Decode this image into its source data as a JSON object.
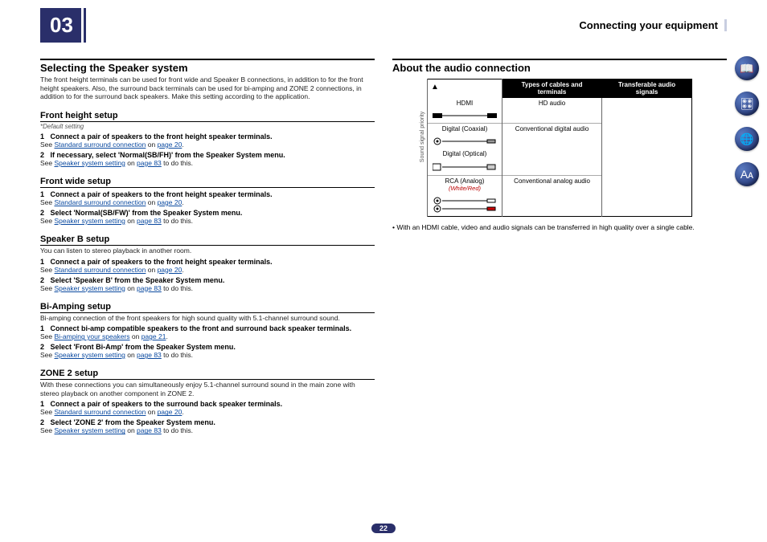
{
  "chapter_number": "03",
  "chapter_title": "Connecting your equipment",
  "page_number": "22",
  "left": {
    "h2": "Selecting the Speaker system",
    "intro": "The front height terminals can be used for front wide and Speaker B connections, in addition to for the front height speakers. Also, the surround back terminals can be used for bi-amping and ZONE 2 connections, in addition to for the surround back speakers. Make this setting according to the application.",
    "sections": [
      {
        "title": "Front height setup",
        "note": "*Default setting",
        "steps": [
          {
            "n": "1",
            "bold": "Connect a pair of speakers to the front height speaker terminals.",
            "see_pre": "See ",
            "link": "Standard surround connection",
            "see_mid": " on ",
            "pg": "page 20",
            "see_post": "."
          },
          {
            "n": "2",
            "bold": "If necessary, select 'Normal(SB/FH)' from the Speaker System menu.",
            "see_pre": "See ",
            "link": "Speaker system setting",
            "see_mid": " on ",
            "pg": "page 83",
            "see_post": " to do this."
          }
        ]
      },
      {
        "title": "Front wide setup",
        "steps": [
          {
            "n": "1",
            "bold": "Connect a pair of speakers to the front height speaker terminals.",
            "see_pre": "See ",
            "link": "Standard surround connection",
            "see_mid": " on ",
            "pg": "page 20",
            "see_post": "."
          },
          {
            "n": "2",
            "bold": "Select 'Normal(SB/FW)' from the Speaker System menu.",
            "see_pre": "See ",
            "link": "Speaker system setting",
            "see_mid": " on ",
            "pg": "page 83",
            "see_post": " to do this."
          }
        ]
      },
      {
        "title": "Speaker B setup",
        "desc": "You can listen to stereo playback in another room.",
        "steps": [
          {
            "n": "1",
            "bold": "Connect a pair of speakers to the front height speaker terminals.",
            "see_pre": "See ",
            "link": "Standard surround connection",
            "see_mid": " on ",
            "pg": "page 20",
            "see_post": "."
          },
          {
            "n": "2",
            "bold": "Select 'Speaker B' from the Speaker System menu.",
            "see_pre": "See ",
            "link": "Speaker system setting",
            "see_mid": " on ",
            "pg": "page 83",
            "see_post": " to do this."
          }
        ]
      },
      {
        "title": "Bi-Amping setup",
        "desc": "Bi-amping connection of the front speakers for high sound quality with 5.1-channel surround sound.",
        "steps": [
          {
            "n": "1",
            "bold": "Connect bi-amp compatible speakers to the front and surround back speaker terminals.",
            "see_pre": "See ",
            "link": "Bi-amping your speakers",
            "see_mid": " on ",
            "pg": "page 21",
            "see_post": "."
          },
          {
            "n": "2",
            "bold": "Select 'Front Bi-Amp' from the Speaker System menu.",
            "see_pre": "See ",
            "link": "Speaker system setting",
            "see_mid": " on ",
            "pg": "page 83",
            "see_post": " to do this."
          }
        ]
      },
      {
        "title": "ZONE 2 setup",
        "desc": "With these connections you can simultaneously enjoy 5.1-channel surround sound in the main zone with stereo playback on another component in ZONE 2.",
        "steps": [
          {
            "n": "1",
            "bold": "Connect a pair of speakers to the surround back speaker terminals.",
            "see_pre": "See ",
            "link": "Standard surround connection",
            "see_mid": " on ",
            "pg": "page 20",
            "see_post": "."
          },
          {
            "n": "2",
            "bold": "Select 'ZONE 2' from the Speaker System menu.",
            "see_pre": "See ",
            "link": "Speaker system setting",
            "see_mid": " on ",
            "pg": "page 83",
            "see_post": " to do this."
          }
        ]
      }
    ]
  },
  "right": {
    "h2": "About the audio connection",
    "table": {
      "th1": "Types of cables and terminals",
      "th2": "Transferable audio signals",
      "priority": "Sound signal priority",
      "rows": [
        {
          "name": "HDMI",
          "signal": "HD audio",
          "sep": false
        },
        {
          "name": "Digital (Coaxial)",
          "signal": "Conventional digital audio",
          "sep": true
        },
        {
          "name": "Digital (Optical)",
          "signal": "",
          "sep": false
        },
        {
          "name": "RCA (Analog)",
          "sub": "(White/Red)",
          "signal": "Conventional analog audio",
          "sep": true
        }
      ]
    },
    "bullet": "With an HDMI cable, video and audio signals can be transferred in high quality over a single cable."
  },
  "sidebar": {
    "icons": [
      {
        "name": "book-icon",
        "glyph": "📖"
      },
      {
        "name": "equipment-icon",
        "glyph": "🎛"
      },
      {
        "name": "globe-icon",
        "glyph": "🌐"
      },
      {
        "name": "letters-icon",
        "glyph": "Aᴀ"
      }
    ]
  }
}
